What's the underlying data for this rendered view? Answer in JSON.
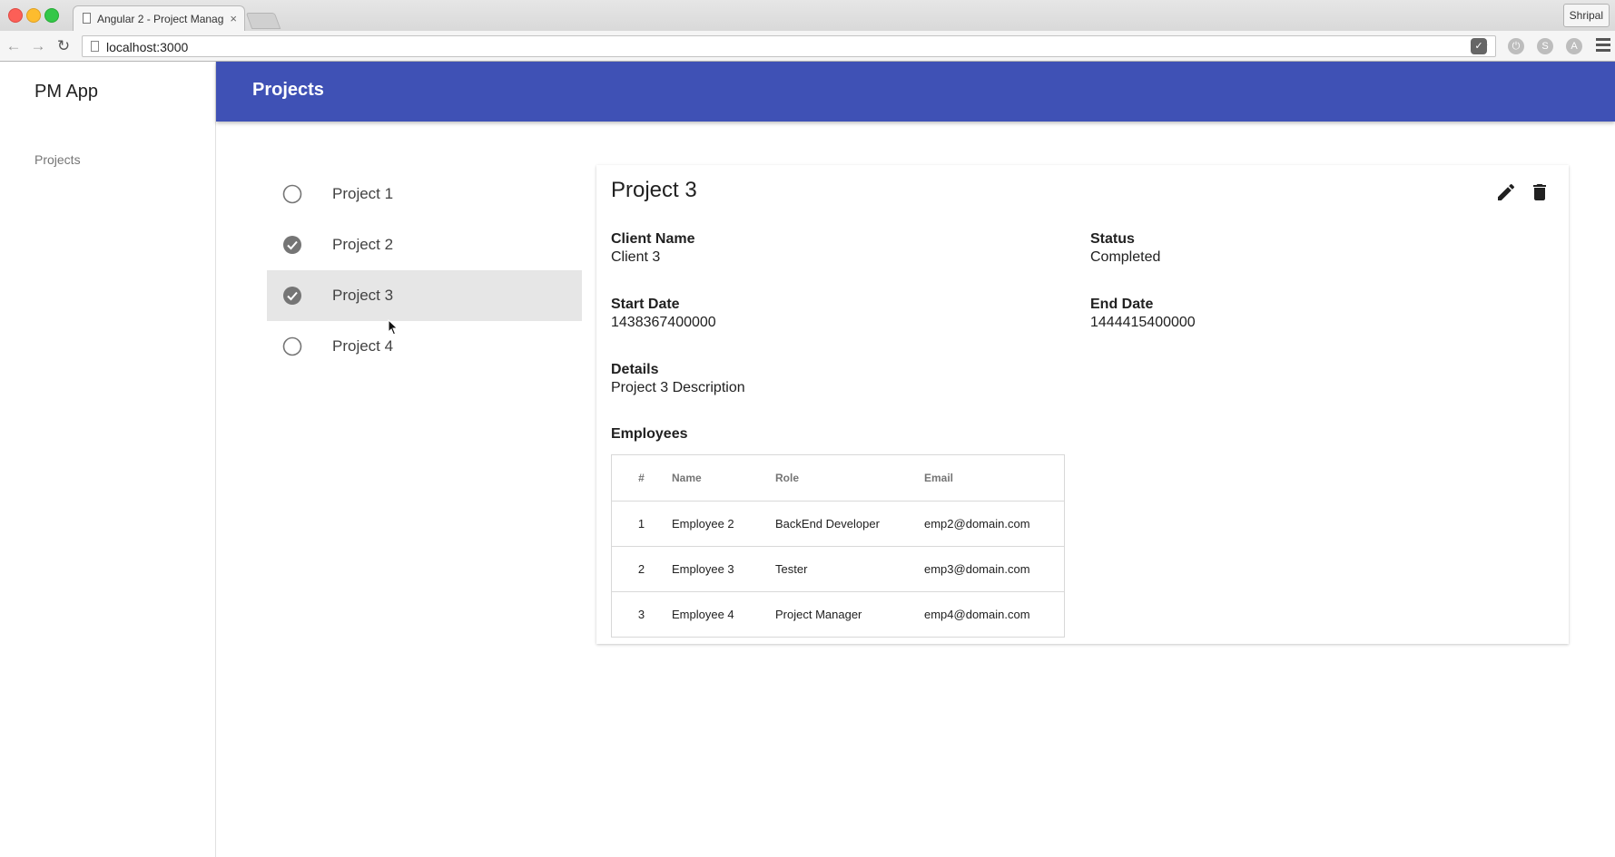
{
  "browser": {
    "tab_title": "Angular 2 - Project Manag",
    "tab_close": "×",
    "url": "localhost:3000",
    "profile_name": "Shripal"
  },
  "app": {
    "logo": "PM App",
    "header_title": "Projects",
    "sidebar": {
      "items": [
        {
          "label": "Projects"
        }
      ]
    }
  },
  "projects": [
    {
      "name": "Project 1",
      "completed": false
    },
    {
      "name": "Project 2",
      "completed": true
    },
    {
      "name": "Project 3",
      "completed": true,
      "selected": true
    },
    {
      "name": "Project 4",
      "completed": false
    }
  ],
  "detail": {
    "title": "Project 3",
    "client_name_label": "Client Name",
    "client_name": "Client 3",
    "status_label": "Status",
    "status": "Completed",
    "start_date_label": "Start Date",
    "start_date": "1438367400000",
    "end_date_label": "End Date",
    "end_date": "1444415400000",
    "details_label": "Details",
    "details": "Project 3 Description",
    "employees_label": "Employees",
    "table": {
      "headers": [
        "#",
        "Name",
        "Role",
        "Email"
      ],
      "rows": [
        [
          "1",
          "Employee 2",
          "BackEnd Developer",
          "emp2@domain.com"
        ],
        [
          "2",
          "Employee 3",
          "Tester",
          "emp3@domain.com"
        ],
        [
          "3",
          "Employee 4",
          "Project Manager",
          "emp4@domain.com"
        ]
      ]
    }
  },
  "colors": {
    "header_bg": "#3f51b5",
    "selected_row_bg": "#e6e6e6",
    "check_done": "#757575",
    "check_empty": "#757575"
  }
}
